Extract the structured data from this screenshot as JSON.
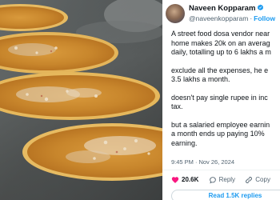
{
  "tweet": {
    "author_name": "Naveen Kopparam",
    "author_handle": "@naveenkopparam",
    "follow_label": "Follow",
    "paragraphs": [
      "A street food dosa vendor near\nhome makes 20k on an averag\ndaily, totalling up to 6 lakhs a m",
      "exclude all the expenses, he e\n3.5 lakhs a month.",
      "doesn't pay single rupee in inc\ntax.",
      "but a salaried employee earnin\na month ends up paying 10%\nearning."
    ],
    "time": "9:45 PM",
    "date": "Nov 26, 2024",
    "like_count": "20.6K",
    "reply_label": "Reply",
    "copy_label": "Copy",
    "read_replies_label": "Read 1.5K replies",
    "like_color": "#f91880",
    "verified_color": "#1d9bf0",
    "icons": [
      "verified-badge-icon",
      "heart-icon",
      "reply-icon",
      "link-icon"
    ]
  },
  "photo": {
    "subject": "dosa-photo",
    "colors": {
      "tawa": "#5a5e5e",
      "dosa_crust": "#c9892e",
      "dosa_edge": "#e7b860",
      "topping": "#e8d8c0"
    }
  }
}
